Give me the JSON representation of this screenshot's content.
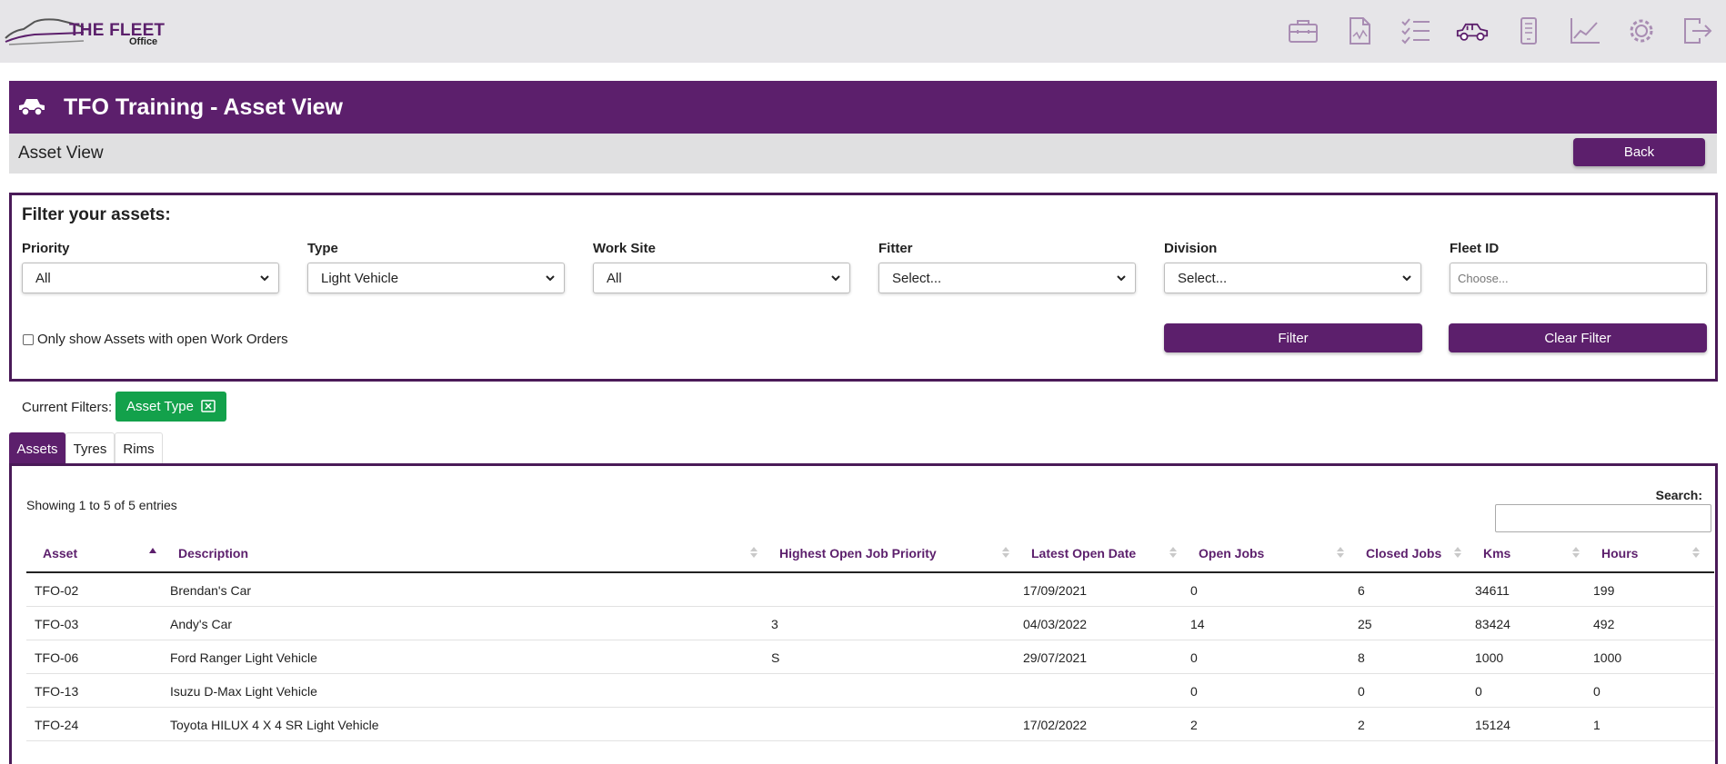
{
  "app": {
    "logo_line1": "THE FLEET",
    "logo_line2": "Office"
  },
  "nav_icons": [
    "toolbox-icon",
    "report-icon",
    "checklist-icon",
    "vehicle-icon",
    "mobile-icon",
    "chart-icon",
    "gear-icon",
    "logout-icon"
  ],
  "header": {
    "title": "TFO Training - Asset View",
    "subtitle": "Asset View",
    "back_label": "Back"
  },
  "filter": {
    "heading": "Filter your assets:",
    "fields": [
      {
        "label": "Priority",
        "value": "All"
      },
      {
        "label": "Type",
        "value": "Light Vehicle"
      },
      {
        "label": "Work Site",
        "value": "All"
      },
      {
        "label": "Fitter",
        "value": "Select..."
      },
      {
        "label": "Division",
        "value": "Select..."
      }
    ],
    "fleet_id_label": "Fleet ID",
    "fleet_id_placeholder": "Choose...",
    "open_orders_label": "Only show Assets with open Work Orders",
    "filter_button": "Filter",
    "clear_button": "Clear Filter"
  },
  "current_filters": {
    "label": "Current Filters:",
    "chips": [
      "Asset Type"
    ]
  },
  "tabs": [
    {
      "label": "Assets",
      "active": true
    },
    {
      "label": "Tyres",
      "active": false
    },
    {
      "label": "Rims",
      "active": false
    }
  ],
  "table": {
    "info": "Showing 1 to 5 of 5 entries",
    "search_label": "Search:",
    "columns": [
      "Asset",
      "Description",
      "Highest Open Job Priority",
      "Latest Open Date",
      "Open Jobs",
      "Closed Jobs",
      "Kms",
      "Hours"
    ],
    "rows": [
      [
        "TFO-02",
        "Brendan's Car",
        "",
        "17/09/2021",
        "0",
        "6",
        "34611",
        "199"
      ],
      [
        "TFO-03",
        "Andy's Car",
        "3",
        "04/03/2022",
        "14",
        "25",
        "83424",
        "492"
      ],
      [
        "TFO-06",
        "Ford Ranger Light Vehicle",
        "S",
        "29/07/2021",
        "0",
        "8",
        "1000",
        "1000"
      ],
      [
        "TFO-13",
        "Isuzu D-Max Light Vehicle",
        "",
        "",
        "0",
        "0",
        "0",
        "0"
      ],
      [
        "TFO-24",
        "Toyota HILUX 4 X 4 SR Light Vehicle",
        "",
        "17/02/2022",
        "2",
        "2",
        "15124",
        "1"
      ]
    ]
  },
  "colors": {
    "brand": "#5c1f6c",
    "chip": "#13a14b",
    "topbar": "#e6e5e8",
    "icon": "#a98db3"
  }
}
